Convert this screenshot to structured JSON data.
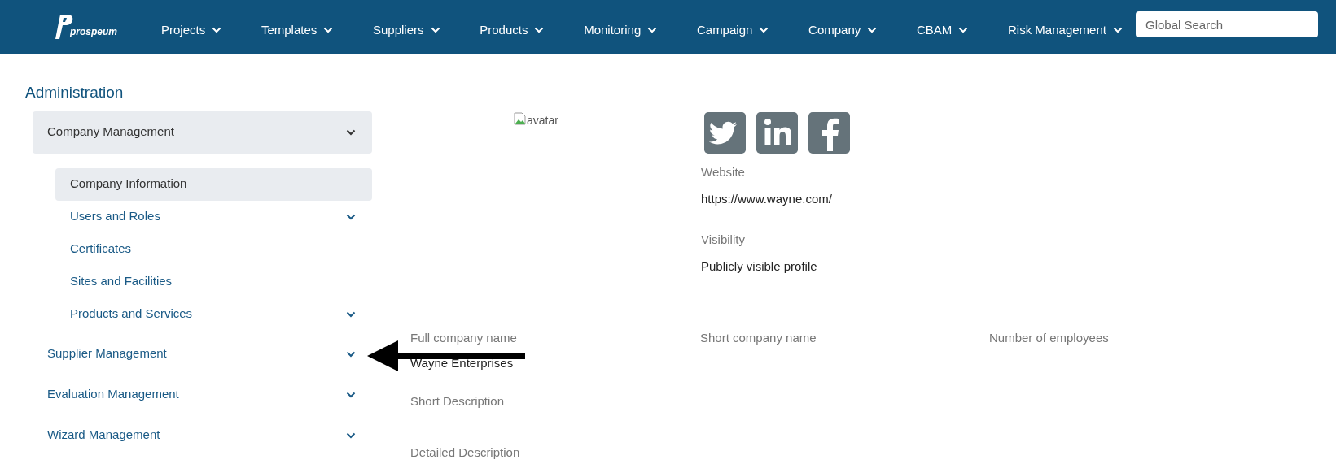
{
  "nav": {
    "logo": "prospeum",
    "items": [
      {
        "label": "Projects"
      },
      {
        "label": "Templates"
      },
      {
        "label": "Suppliers"
      },
      {
        "label": "Products"
      },
      {
        "label": "Monitoring"
      },
      {
        "label": "Campaign"
      },
      {
        "label": "Company"
      },
      {
        "label": "CBAM"
      },
      {
        "label": "Risk Management"
      }
    ],
    "search": {
      "placeholder": "Global Search"
    }
  },
  "sidebar": {
    "title": "Administration",
    "items": [
      {
        "label": "Company Management",
        "expanded": true,
        "has_children": true,
        "children": [
          {
            "label": "Company Information",
            "selected": true,
            "has_children": false
          },
          {
            "label": "Users and Roles",
            "selected": false,
            "has_children": true
          },
          {
            "label": "Certificates",
            "selected": false,
            "has_children": false
          },
          {
            "label": "Sites and Facilities",
            "selected": false,
            "has_children": false
          },
          {
            "label": "Products and Services",
            "selected": false,
            "has_children": true
          }
        ]
      },
      {
        "label": "Supplier Management",
        "expanded": false,
        "has_children": true
      },
      {
        "label": "Evaluation Management",
        "expanded": false,
        "has_children": true
      },
      {
        "label": "Wizard Management",
        "expanded": false,
        "has_children": true
      }
    ]
  },
  "profile": {
    "avatar_alt": "avatar",
    "social": [
      {
        "kind": "twitter"
      },
      {
        "kind": "linkedin"
      },
      {
        "kind": "facebook"
      }
    ],
    "fields": [
      {
        "label": "Website",
        "value": "https://www.wayne.com/"
      },
      {
        "label": "Visibility",
        "value": "Publicly visible profile"
      }
    ],
    "details": [
      {
        "label": "Full company name",
        "value": "Wayne Enterprises"
      },
      {
        "label": "Short company name"
      },
      {
        "label": "Number of employees"
      }
    ],
    "descriptions": [
      {
        "label": "Short Description"
      },
      {
        "label": "Detailed Description"
      }
    ]
  }
}
